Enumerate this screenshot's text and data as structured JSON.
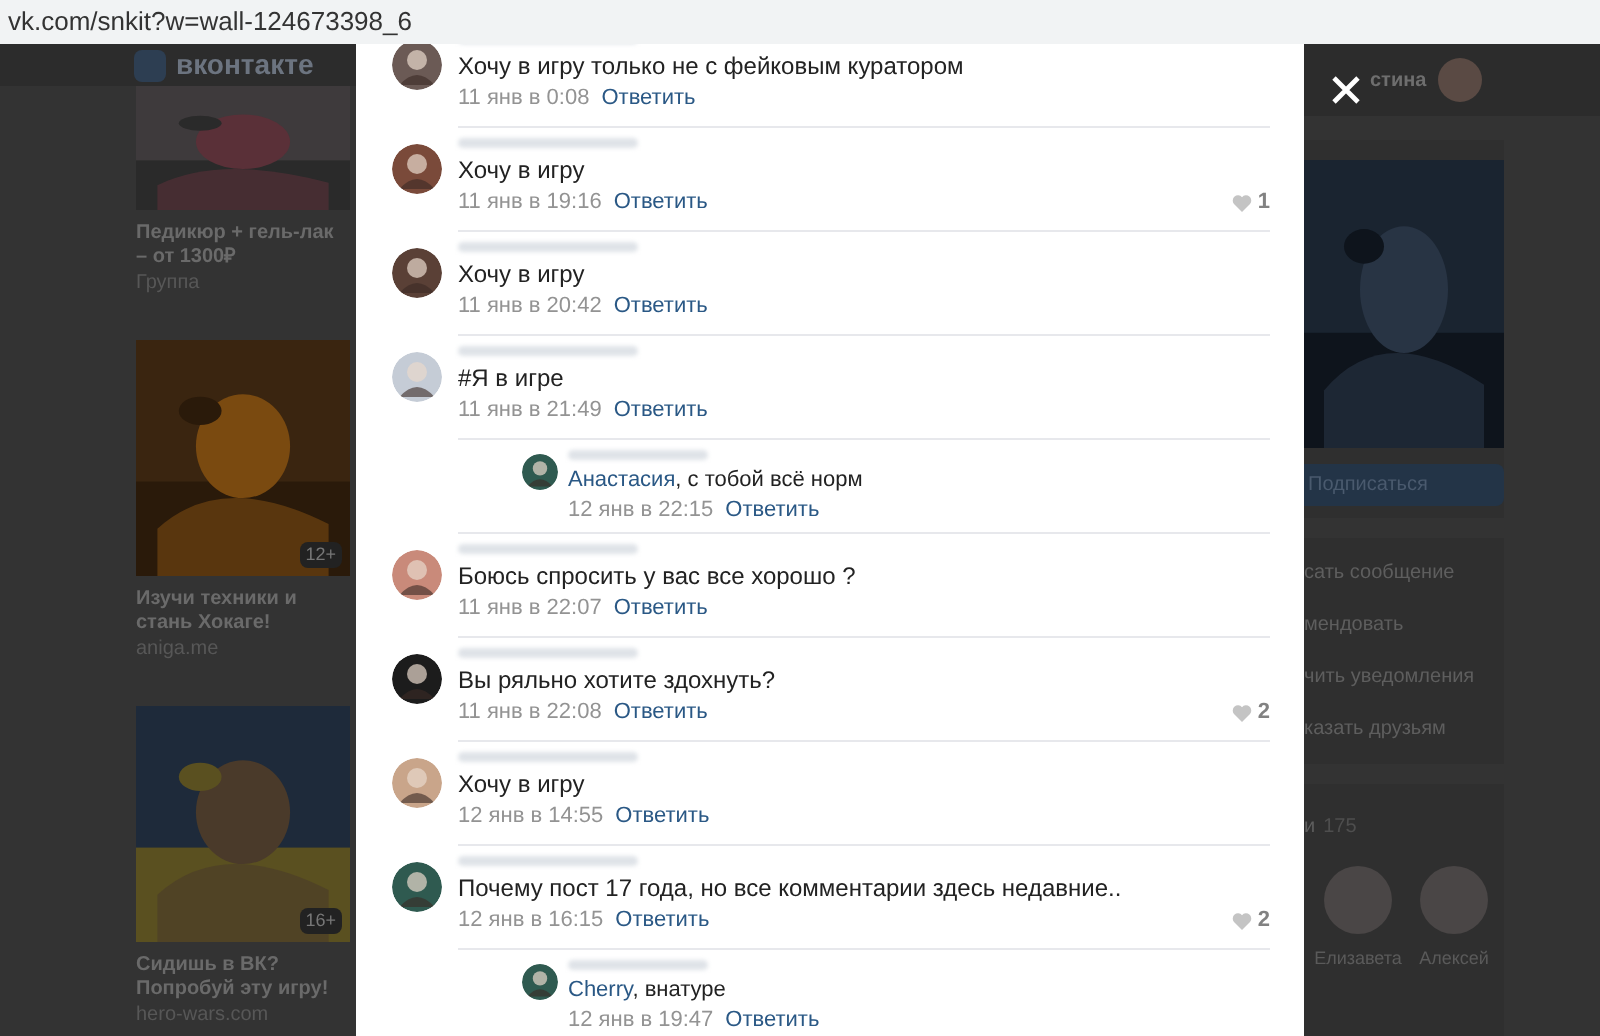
{
  "address_bar": {
    "url": "vk.com/snkit?w=wall-124673398_6"
  },
  "header": {
    "logo_text": "вконтакте",
    "user_name": "стина"
  },
  "ads": [
    {
      "title": "Педикюр + гель-лак – от 1300₽",
      "source": "Группа"
    },
    {
      "title": "Изучи техники и стань Хокаге!",
      "source": "aniga.me",
      "age": "12+"
    },
    {
      "title": "Сидишь в ВК? Попробуй эту игру!",
      "source": "hero-wars.com",
      "age": "16+"
    }
  ],
  "right_column": {
    "subscribe_button": "Подписаться",
    "actions": [
      "сать сообщение",
      "мендовать",
      "чить уведомления",
      "казать друзьям"
    ],
    "members_label": "и",
    "members_count": "175",
    "members": [
      "Елизавета",
      "Алексей"
    ]
  },
  "comments": [
    {
      "text": "Хочу в игру только не с фейковым куратором",
      "date": "11 янв в 0:08",
      "reply": "Ответить"
    },
    {
      "text": "Хочу в игру",
      "date": "11 янв в 19:16",
      "reply": "Ответить",
      "likes": "1"
    },
    {
      "text": "Хочу в игру",
      "date": "11 янв в 20:42",
      "reply": "Ответить"
    },
    {
      "text": "#Я в игре",
      "date": "11 янв в 21:49",
      "reply": "Ответить",
      "replies": [
        {
          "mention": "Анастасия",
          "text": ", с тобой всё норм",
          "date": "12 янв в 22:15",
          "reply": "Ответить"
        }
      ]
    },
    {
      "text": "Боюсь спросить у вас все хорошо ?",
      "date": "11 янв в 22:07",
      "reply": "Ответить"
    },
    {
      "text": "Вы ряльно хотите здохнуть?",
      "date": "11 янв в 22:08",
      "reply": "Ответить",
      "likes": "2"
    },
    {
      "text": "Хочу в игру",
      "date": "12 янв в 14:55",
      "reply": "Ответить"
    },
    {
      "text": "Почему пост 17 года, но все комментарии здесь недавние..",
      "date": "12 янв в 16:15",
      "reply": "Ответить",
      "likes": "2",
      "replies": [
        {
          "mention": "Cherry",
          "text": ", внатуре",
          "date": "12 янв в 19:47",
          "reply": "Ответить"
        }
      ]
    }
  ]
}
